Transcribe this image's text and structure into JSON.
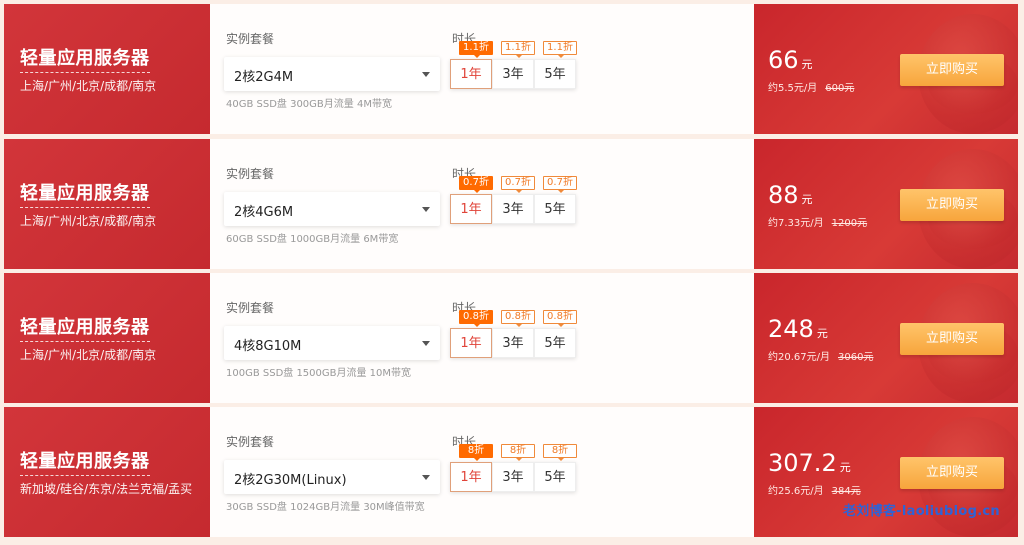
{
  "labels": {
    "package": "实例套餐",
    "duration": "时长",
    "unit": "元",
    "buy": "立即购买"
  },
  "rows": [
    {
      "title": "轻量应用服务器",
      "regions": "上海/广州/北京/成都/南京",
      "package": "2核2G4M",
      "spec": "40GB SSD盘 300GB月流量 4M带宽",
      "durations": [
        {
          "label": "1年",
          "badge": "1.1折",
          "active": true
        },
        {
          "label": "3年",
          "badge": "1.1折",
          "active": false
        },
        {
          "label": "5年",
          "badge": "1.1折",
          "active": false
        }
      ],
      "price": "66",
      "monthly": "约5.5元/月",
      "original": "600元"
    },
    {
      "title": "轻量应用服务器",
      "regions": "上海/广州/北京/成都/南京",
      "package": "2核4G6M",
      "spec": "60GB SSD盘 1000GB月流量 6M带宽",
      "durations": [
        {
          "label": "1年",
          "badge": "0.7折",
          "active": true
        },
        {
          "label": "3年",
          "badge": "0.7折",
          "active": false
        },
        {
          "label": "5年",
          "badge": "0.7折",
          "active": false
        }
      ],
      "price": "88",
      "monthly": "约7.33元/月",
      "original": "1200元"
    },
    {
      "title": "轻量应用服务器",
      "regions": "上海/广州/北京/成都/南京",
      "package": "4核8G10M",
      "spec": "100GB SSD盘 1500GB月流量 10M带宽",
      "durations": [
        {
          "label": "1年",
          "badge": "0.8折",
          "active": true
        },
        {
          "label": "3年",
          "badge": "0.8折",
          "active": false
        },
        {
          "label": "5年",
          "badge": "0.8折",
          "active": false
        }
      ],
      "price": "248",
      "monthly": "约20.67元/月",
      "original": "3060元"
    },
    {
      "title": "轻量应用服务器",
      "regions": "新加坡/硅谷/东京/法兰克福/孟买",
      "package": "2核2G30M(Linux)",
      "spec": "30GB SSD盘 1024GB月流量 30M峰值带宽",
      "durations": [
        {
          "label": "1年",
          "badge": "8折",
          "active": true
        },
        {
          "label": "3年",
          "badge": "8折",
          "active": false
        },
        {
          "label": "5年",
          "badge": "8折",
          "active": false
        }
      ],
      "price": "307.2",
      "monthly": "约25.6元/月",
      "original": "384元"
    }
  ],
  "watermark": "老刘博客-laoliublog.cn"
}
